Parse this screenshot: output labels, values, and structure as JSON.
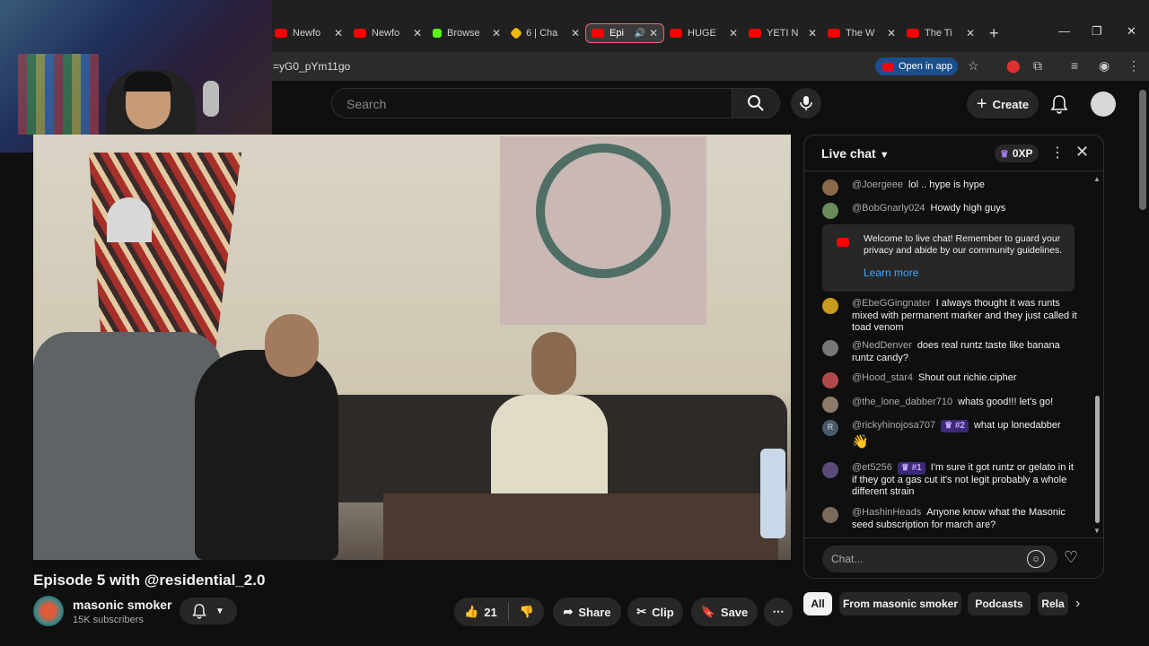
{
  "browser": {
    "tabs": [
      {
        "label": "Newfo",
        "favicon": "youtube-icon",
        "active": false
      },
      {
        "label": "Newfo",
        "favicon": "youtube-icon",
        "active": false
      },
      {
        "label": "Browse",
        "favicon": "kick-icon",
        "active": false
      },
      {
        "label": "6 | Cha",
        "favicon": "binance-icon",
        "active": false
      },
      {
        "label": "Epi",
        "favicon": "youtube-icon",
        "active": true
      },
      {
        "label": "HUGE",
        "favicon": "youtube-icon",
        "active": false
      },
      {
        "label": "YETI N",
        "favicon": "youtube-icon",
        "active": false
      },
      {
        "label": "The W",
        "favicon": "youtube-icon",
        "active": false
      },
      {
        "label": "The Ti",
        "favicon": "youtube-icon",
        "active": false
      }
    ],
    "new_tab": "+",
    "address": "=yG0_pYm11go",
    "open_in_app": "Open in app",
    "controls": {
      "minimize": "—",
      "restore": "❐",
      "close": "✕"
    }
  },
  "masthead": {
    "search_placeholder": "Search",
    "create_label": "Create"
  },
  "video": {
    "title": "Episode 5 with @residential_2.0",
    "channel": "masonic smoker",
    "subscribers": "15K subscribers",
    "likes": "21",
    "share": "Share",
    "clip": "Clip",
    "save": "Save"
  },
  "chat": {
    "title": "Live chat",
    "xp": "0XP",
    "input_placeholder": "Chat...",
    "welcome": {
      "text": "Welcome to live chat! Remember to guard your privacy and abide by our community guidelines.",
      "link": "Learn more"
    },
    "messages": [
      {
        "author": "@Joergeee",
        "text": "lol .. hype is hype",
        "avatar_color": "#8a6a4a"
      },
      {
        "author": "@BobGnarly024",
        "text": "Howdy high guys",
        "avatar_color": "#6a8a5a"
      },
      {
        "author": "@EbeGGingnater",
        "text": "I always thought it was runts mixed with permanent marker and they just called it toad venom",
        "avatar_color": "#c89a20"
      },
      {
        "author": "@NedDenver",
        "text": "does real runtz taste like banana runtz candy?",
        "avatar_color": "#777777"
      },
      {
        "author": "@Hood_star4",
        "text": "Shout out richie.cipher",
        "avatar_color": "#b04a4a"
      },
      {
        "author": "@the_lone_dabber710",
        "text": "whats good!!! let's go!",
        "avatar_color": "#8a7a6a"
      },
      {
        "author": "@rickyhinojosa707",
        "badge": "#2",
        "text": "what up lonedabber",
        "emoji": "👋",
        "avatar_letter": "R",
        "avatar_color": "#4a5a6a"
      },
      {
        "author": "@et5256",
        "badge": "#1",
        "text": "I'm sure it got runtz or gelato in it if they got a gas cut it's not legit probably a whole different strain",
        "avatar_color": "#5a4a7a"
      },
      {
        "author": "@HashinHeads",
        "text": "Anyone know what the Masonic seed subscription for march are?",
        "avatar_color": "#7a6a5a"
      }
    ]
  },
  "chips": [
    "All",
    "From masonic smoker",
    "Podcasts",
    "Rela"
  ]
}
